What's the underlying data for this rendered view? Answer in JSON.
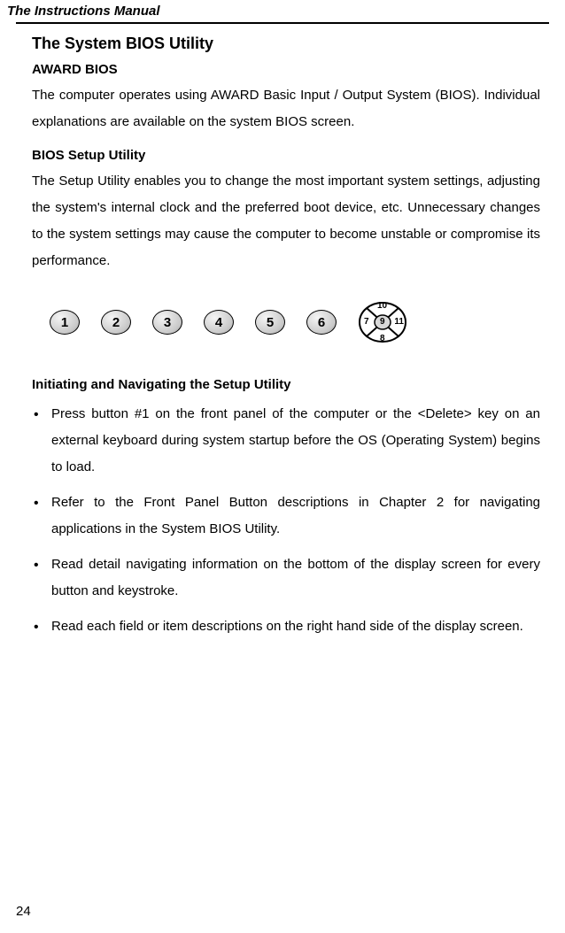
{
  "header": "The Instructions Manual",
  "title": "The System BIOS Utility",
  "section1": {
    "heading": "AWARD BIOS",
    "para": "The computer operates using AWARD Basic Input / Output System (BIOS). Individual explanations are available on the system BIOS screen."
  },
  "section2": {
    "heading": "BIOS Setup Utility",
    "para": "The Setup Utility enables you to change the most important system settings, adjusting the system's internal clock and the preferred boot device, etc. Unnecessary changes to the system settings may cause the computer to become unstable or compromise its performance."
  },
  "buttons": [
    "1",
    "2",
    "3",
    "4",
    "5",
    "6"
  ],
  "dpad": {
    "top": "10",
    "right": "11",
    "bottom": "8",
    "left": "7",
    "center": "9"
  },
  "section3": {
    "heading": "Initiating and Navigating the Setup Utility",
    "bullets": [
      "Press button #1 on the front panel of the computer or the <Delete> key on an external keyboard during system startup before the OS (Operating System) begins to load.",
      "Refer to the Front Panel Button descriptions in Chapter 2 for navigating applications in the System BIOS Utility.",
      "Read detail navigating information on the bottom of the display screen for every button and keystroke.",
      "Read each field or item descriptions on the right hand side of the display screen."
    ]
  },
  "page_number": "24"
}
